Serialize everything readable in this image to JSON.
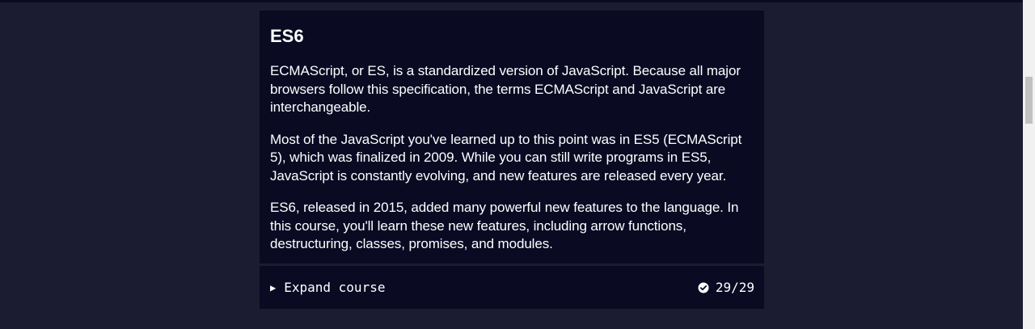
{
  "card": {
    "title": "ES6",
    "paragraphs": [
      "ECMAScript, or ES, is a standardized version of JavaScript. Because all major browsers follow this specification, the terms ECMAScript and JavaScript are interchangeable.",
      "Most of the JavaScript you've learned up to this point was in ES5 (ECMAScript 5), which was finalized in 2009. While you can still write programs in ES5, JavaScript is constantly evolving, and new features are released every year.",
      "ES6, released in 2015, added many powerful new features to the language. In this course, you'll learn these new features, including arrow functions, destructuring, classes, promises, and modules."
    ],
    "expand_icon": "▶",
    "expand_label": "Expand course",
    "progress_icon": "check-circle-icon",
    "progress": "29/29"
  }
}
